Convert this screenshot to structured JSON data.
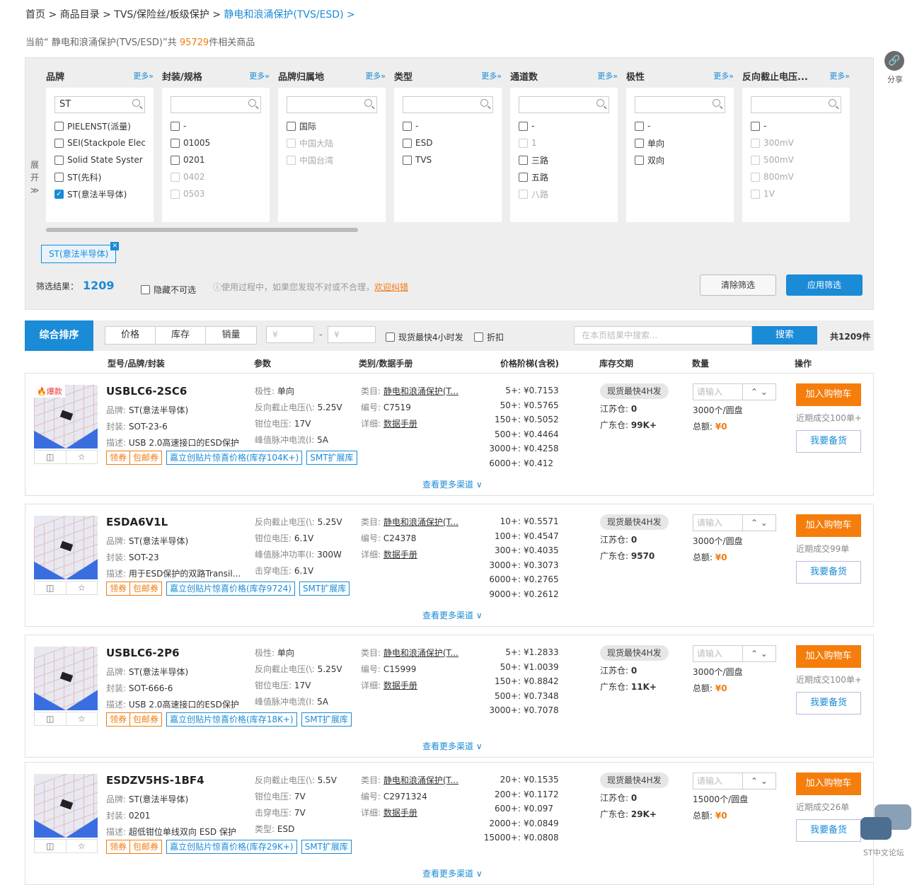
{
  "breadcrumb": {
    "home": "首页",
    "sep": ">",
    "catalog": "商品目录",
    "l2": "TVS/保险丝/板级保护",
    "current": "静电和浪涌保护(TVS/ESD) >"
  },
  "summary": {
    "prefix": "当前“ 静电和浪涌保护(TVS/ESD)”共",
    "count": "95729",
    "suffix": "件相关商品"
  },
  "share": {
    "label": "分享"
  },
  "filter": {
    "expand": [
      "展",
      "开"
    ],
    "columns": [
      {
        "name": "品牌",
        "more": "更多»",
        "search": "ST",
        "options": [
          {
            "t": "PIELENST(派量)",
            "s": ""
          },
          {
            "t": "SEI(Stackpole Elec",
            "s": ""
          },
          {
            "t": "Solid State Syster",
            "s": ""
          },
          {
            "t": "ST(先科)",
            "s": ""
          },
          {
            "t": "ST(意法半导体)",
            "s": "chk"
          }
        ]
      },
      {
        "name": "封装/规格",
        "more": "更多»",
        "search": "",
        "options": [
          {
            "t": "-",
            "s": ""
          },
          {
            "t": "01005",
            "s": ""
          },
          {
            "t": "0201",
            "s": ""
          },
          {
            "t": "0402",
            "s": "dis"
          },
          {
            "t": "0503",
            "s": "dis"
          }
        ]
      },
      {
        "name": "品牌归属地",
        "more": "更多»",
        "search": "",
        "options": [
          {
            "t": "国际",
            "s": ""
          },
          {
            "t": "中国大陆",
            "s": "dis"
          },
          {
            "t": "中国台湾",
            "s": "dis"
          }
        ]
      },
      {
        "name": "类型",
        "more": "更多»",
        "search": "",
        "options": [
          {
            "t": "-",
            "s": ""
          },
          {
            "t": "ESD",
            "s": ""
          },
          {
            "t": "TVS",
            "s": ""
          }
        ]
      },
      {
        "name": "通道数",
        "more": "更多»",
        "search": "",
        "options": [
          {
            "t": "-",
            "s": ""
          },
          {
            "t": "1",
            "s": "dis"
          },
          {
            "t": "三路",
            "s": ""
          },
          {
            "t": "五路",
            "s": ""
          },
          {
            "t": "八路",
            "s": "dis"
          }
        ]
      },
      {
        "name": "极性",
        "more": "更多»",
        "search": "",
        "options": [
          {
            "t": "-",
            "s": ""
          },
          {
            "t": "单向",
            "s": ""
          },
          {
            "t": "双向",
            "s": ""
          }
        ]
      },
      {
        "name": "反向截止电压...",
        "more": "更多»",
        "search": "",
        "options": [
          {
            "t": "-",
            "s": ""
          },
          {
            "t": "300mV",
            "s": "dis"
          },
          {
            "t": "500mV",
            "s": "dis"
          },
          {
            "t": "800mV",
            "s": "dis"
          },
          {
            "t": "1V",
            "s": "dis"
          }
        ]
      }
    ],
    "selected_tag": "ST(意法半导体)",
    "result_label": "筛选结果：",
    "result_count": "1209",
    "hide_label": "隐藏不可选",
    "info": "ⓘ使用过程中，如果您发现不对或不合理，",
    "info_link": "欢迎纠错",
    "clear": "清除筛选",
    "apply": "应用筛选"
  },
  "sortbar": {
    "main": "综合排序",
    "tabs": [
      "价格",
      "库存",
      "销量"
    ],
    "price_from": "¥",
    "price_to": "¥",
    "dash": "-",
    "fast": "现货最快4小时发",
    "discount": "折扣",
    "search_placeholder": "在本页结果中搜索...",
    "search_btn": "搜索",
    "total": "共1209件"
  },
  "thead": [
    "型号/品牌/封装",
    "参数",
    "类别/数据手册",
    "价格阶梯(含税)",
    "库存交期",
    "数量",
    "操作"
  ],
  "products": [
    {
      "hot": "🔥爆款",
      "pn": "USBLC6-2SC6",
      "brand": "ST(意法半导体)",
      "pkg": "SOT-23-6",
      "desc": "USB 2.0高速接口的ESD保护",
      "params": [
        [
          "极性:",
          "单向"
        ],
        [
          "反向截止电压(\\:",
          "5.25V"
        ],
        [
          "钳位电压:",
          "17V"
        ],
        [
          "峰值脉冲电流(I:",
          "5A"
        ]
      ],
      "cat": "静电和浪涌保护(T...",
      "code": "C7519",
      "price": [
        [
          "5+:",
          "¥0.7153"
        ],
        [
          "50+:",
          "¥0.5765"
        ],
        [
          "150+:",
          "¥0.5052"
        ],
        [
          "500+:",
          "¥0.4464"
        ],
        [
          "3000+:",
          "¥0.4258"
        ],
        [
          "6000+:",
          "¥0.412"
        ]
      ],
      "js": "0",
      "gd": "99K+",
      "pack": "3000个/圆盘",
      "recent": "近期成交100单+",
      "badge": "嘉立创贴片惊喜价格(库存104K+)"
    },
    {
      "hot": "",
      "pn": "ESDA6V1L",
      "brand": "ST(意法半导体)",
      "pkg": "SOT-23",
      "desc": "用于ESD保护的双路Transil...",
      "params": [
        [
          "反向截止电压(\\:",
          "5.25V"
        ],
        [
          "钳位电压:",
          "6.1V"
        ],
        [
          "峰值脉冲功率(I:",
          "300W"
        ],
        [
          "击穿电压:",
          "6.1V"
        ]
      ],
      "cat": "静电和浪涌保护(T...",
      "code": "C24378",
      "price": [
        [
          "10+:",
          "¥0.5571"
        ],
        [
          "100+:",
          "¥0.4547"
        ],
        [
          "300+:",
          "¥0.4035"
        ],
        [
          "3000+:",
          "¥0.3073"
        ],
        [
          "6000+:",
          "¥0.2765"
        ],
        [
          "9000+:",
          "¥0.2612"
        ]
      ],
      "js": "0",
      "gd": "9570",
      "pack": "3000个/圆盘",
      "recent": "近期成交99单",
      "badge": "嘉立创贴片惊喜价格(库存9724)"
    },
    {
      "hot": "",
      "pn": "USBLC6-2P6",
      "brand": "ST(意法半导体)",
      "pkg": "SOT-666-6",
      "desc": "USB 2.0高速接口的ESD保护",
      "params": [
        [
          "极性:",
          "单向"
        ],
        [
          "反向截止电压(\\:",
          "5.25V"
        ],
        [
          "钳位电压:",
          "17V"
        ],
        [
          "峰值脉冲电流(I:",
          "5A"
        ]
      ],
      "cat": "静电和浪涌保护(T...",
      "code": "C15999",
      "price": [
        [
          "5+:",
          "¥1.2833"
        ],
        [
          "50+:",
          "¥1.0039"
        ],
        [
          "150+:",
          "¥0.8842"
        ],
        [
          "500+:",
          "¥0.7348"
        ],
        [
          "3000+:",
          "¥0.7078"
        ]
      ],
      "js": "0",
      "gd": "11K+",
      "pack": "3000个/圆盘",
      "recent": "近期成交100单+",
      "badge": "嘉立创贴片惊喜价格(库存18K+)"
    },
    {
      "hot": "",
      "pn": "ESDZV5HS-1BF4",
      "brand": "ST(意法半导体)",
      "pkg": "0201",
      "desc": "超低钳位单线双向 ESD 保护",
      "params": [
        [
          "反向截止电压(\\:",
          "5.5V"
        ],
        [
          "钳位电压:",
          "7V"
        ],
        [
          "击穿电压:",
          "7V"
        ],
        [
          "类型:",
          "ESD"
        ]
      ],
      "cat": "静电和浪涌保护(T...",
      "code": "C2971324",
      "price": [
        [
          "20+:",
          "¥0.1535"
        ],
        [
          "200+:",
          "¥0.1172"
        ],
        [
          "600+:",
          "¥0.097"
        ],
        [
          "2000+:",
          "¥0.0849"
        ],
        [
          "15000+:",
          "¥0.0808"
        ]
      ],
      "js": "0",
      "gd": "29K+",
      "pack": "15000个/圆盘",
      "recent": "近期成交26单",
      "badge": "嘉立创贴片惊喜价格(库存29K+)"
    }
  ],
  "labels": {
    "brand": "品牌:",
    "pkg": "封装:",
    "desc": "描述:",
    "cat": "类目:",
    "code": "编号:",
    "detail": "详细:",
    "datasheet": "数据手册",
    "fast": "现货最快4H发",
    "js": "江苏仓:",
    "gd": "广东仓:",
    "qty_ph": "请输入",
    "total": "总额:",
    "total_val": "¥0",
    "cart": "加入购物车",
    "backup": "我要备货",
    "more": "查看更多渠道 ∨",
    "coupon": "领券",
    "ship": "包邮券",
    "smt": "SMT扩展库"
  },
  "chat": {
    "label": "ST中文论坛"
  }
}
